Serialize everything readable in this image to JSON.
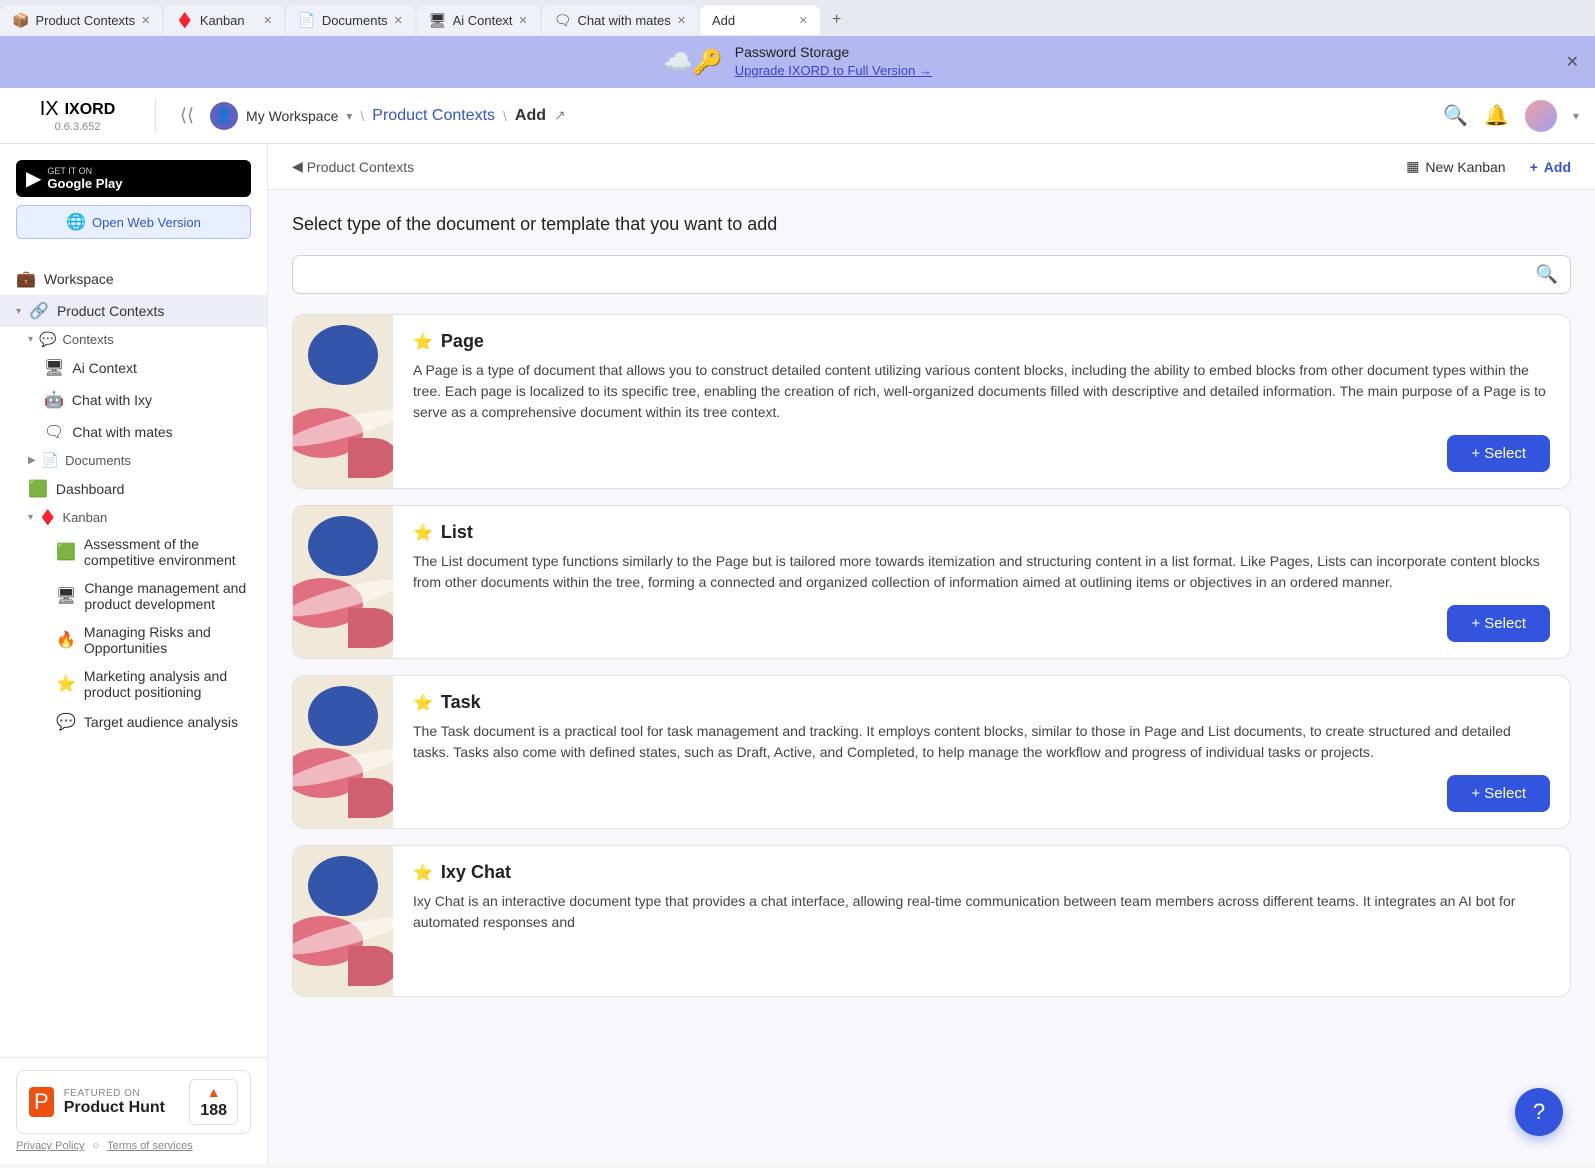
{
  "tabs": [
    {
      "id": "product-contexts",
      "label": "Product Contexts",
      "icon": "📦",
      "active": false
    },
    {
      "id": "kanban",
      "label": "Kanban",
      "icon": "♦️",
      "active": false
    },
    {
      "id": "documents",
      "label": "Documents",
      "icon": "📄",
      "active": false
    },
    {
      "id": "ai-context",
      "label": "Ai Context",
      "icon": "🖥",
      "active": false
    },
    {
      "id": "chat-with-mates",
      "label": "Chat with mates",
      "icon": "🗨",
      "active": false
    },
    {
      "id": "add",
      "label": "Add",
      "active": true
    }
  ],
  "banner": {
    "icon": "☁️🔑",
    "title": "Password Storage",
    "subtitle": "Upgrade IXORD to Full Version →"
  },
  "header": {
    "logo": "IXORD",
    "version": "0.6.3.652",
    "workspace": "My Workspace",
    "breadcrumb": [
      "My Workspace",
      "Product Contexts",
      "Add"
    ],
    "google_play_label": "GET IT ON\nGoogle Play",
    "web_version_label": "Open Web Version",
    "collapse_hint": "⟨⟨"
  },
  "sidebar": {
    "workspace_label": "Workspace",
    "product_contexts_label": "Product Contexts",
    "contexts_label": "Contexts",
    "ai_context_label": "Ai Context",
    "chat_ixy_label": "Chat with Ixy",
    "chat_mates_label": "Chat with mates",
    "documents_label": "Documents",
    "dashboard_label": "Dashboard",
    "kanban_label": "Kanban",
    "kanban_items": [
      "Assessment of the competitive environment",
      "Change management and product development",
      "Managing Risks and Opportunities",
      "Marketing analysis and product positioning",
      "Target audience analysis"
    ]
  },
  "product_hunt": {
    "featured_on": "FEATURED ON",
    "product_hunt": "Product Hunt",
    "count": "188",
    "privacy_policy": "Privacy Policy",
    "terms": "Terms of services"
  },
  "content": {
    "back_label": "Product Contexts",
    "nav_new_kanban": "New Kanban",
    "nav_add": "Add",
    "page_title": "Select type of the document or template that you want to add",
    "search_placeholder": "",
    "cards": [
      {
        "id": "page",
        "star": "⭐",
        "title": "Page",
        "description": "A Page is a type of document that allows you to construct detailed content utilizing various content blocks, including the ability to embed blocks from other document types within the tree. Each page is localized to its specific tree, enabling the creation of rich, well-organized documents filled with descriptive and detailed information. The main purpose of a Page is to serve as a comprehensive document within its tree context.",
        "select_label": "+ Select"
      },
      {
        "id": "list",
        "star": "⭐",
        "title": "List",
        "description": "The List document type functions similarly to the Page but is tailored more towards itemization and structuring content in a list format. Like Pages, Lists can incorporate content blocks from other documents within the tree, forming a connected and organized collection of information aimed at outlining items or objectives in an ordered manner.",
        "select_label": "+ Select"
      },
      {
        "id": "task",
        "star": "⭐",
        "title": "Task",
        "description": "The Task document is a practical tool for task management and tracking. It employs content blocks, similar to those in Page and List documents, to create structured and detailed tasks. Tasks also come with defined states, such as Draft, Active, and Completed, to help manage the workflow and progress of individual tasks or projects.",
        "select_label": "+ Select"
      },
      {
        "id": "ixy-chat",
        "star": "⭐",
        "title": "Ixy Chat",
        "description": "Ixy Chat is an interactive document type that provides a chat interface, allowing real-time communication between team members across different teams. It integrates an AI bot for automated responses and",
        "select_label": "+ Select"
      }
    ]
  },
  "fab": {
    "icon": "?"
  }
}
